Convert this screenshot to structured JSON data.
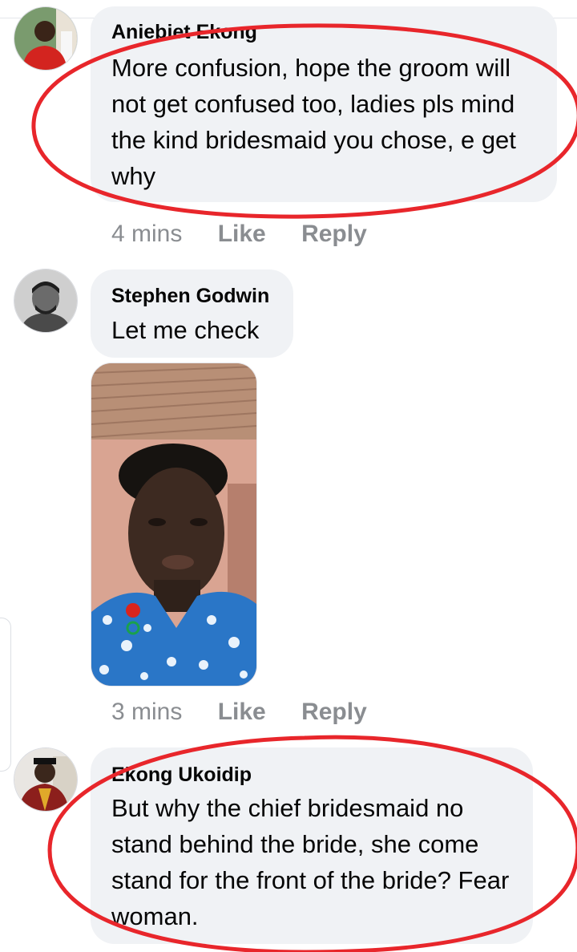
{
  "comments": [
    {
      "author": "Aniebiet Ekong",
      "text": "More confusion, hope the groom will not get confused too, ladies pls mind the kind bridesmaid you chose, e get why",
      "time": "4 mins",
      "like_label": "Like",
      "reply_label": "Reply"
    },
    {
      "author": "Stephen Godwin",
      "text": "Let me check",
      "time": "3 mins",
      "like_label": "Like",
      "reply_label": "Reply"
    },
    {
      "author": "Ekong Ukoidip",
      "text": "But why the chief bridesmaid no stand behind the bride, she come stand for the front of the bride? Fear woman."
    }
  ],
  "colors": {
    "bubble": "#f0f2f5",
    "meta_text": "#8a8d91",
    "annotation_ring": "#e8262b"
  }
}
